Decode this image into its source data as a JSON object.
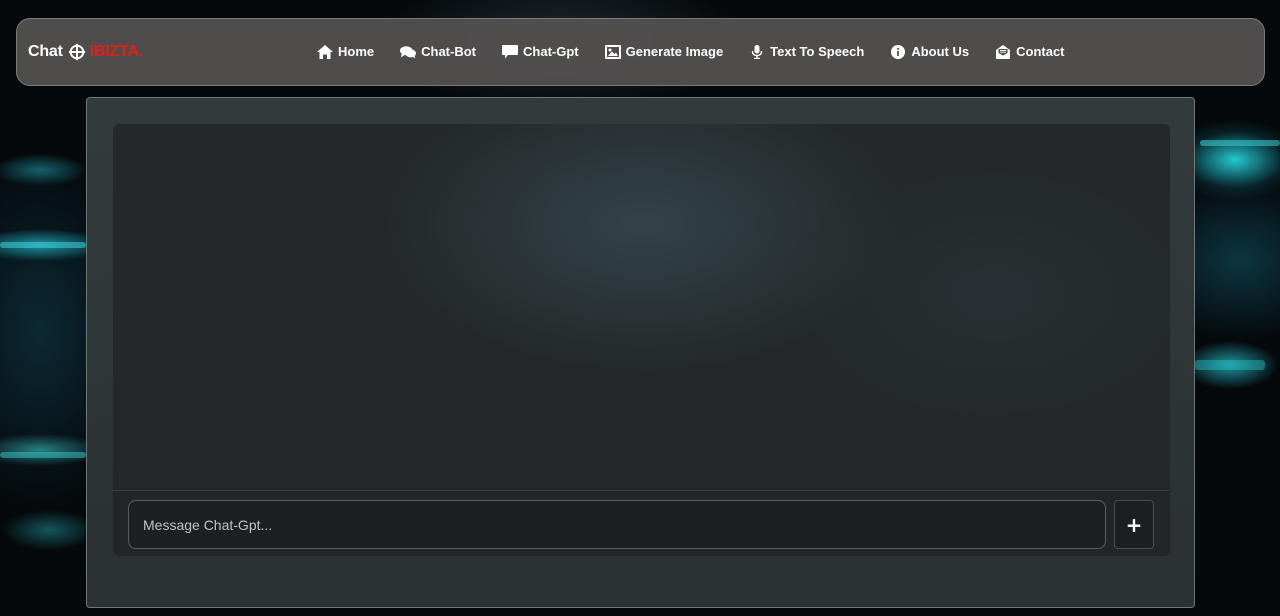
{
  "brand": {
    "part1": "Chat",
    "part2": "IBIZTA."
  },
  "nav": {
    "items": [
      {
        "label": "Home",
        "icon": "home-icon"
      },
      {
        "label": "Chat-Bot",
        "icon": "comments-icon"
      },
      {
        "label": "Chat-Gpt",
        "icon": "message-icon"
      },
      {
        "label": "Generate Image",
        "icon": "image-icon"
      },
      {
        "label": "Text To Speech",
        "icon": "microphone-icon"
      },
      {
        "label": "About Us",
        "icon": "info-icon"
      },
      {
        "label": "Contact",
        "icon": "envelope-icon"
      }
    ]
  },
  "chat": {
    "input_placeholder": "Message Chat-Gpt...",
    "input_value": "",
    "send_label": "+"
  },
  "colors": {
    "brand_accent": "#e0211b",
    "navbar_bg": "#52504e",
    "panel_bg": "#343c3e",
    "background_glow": "#28dce6"
  }
}
